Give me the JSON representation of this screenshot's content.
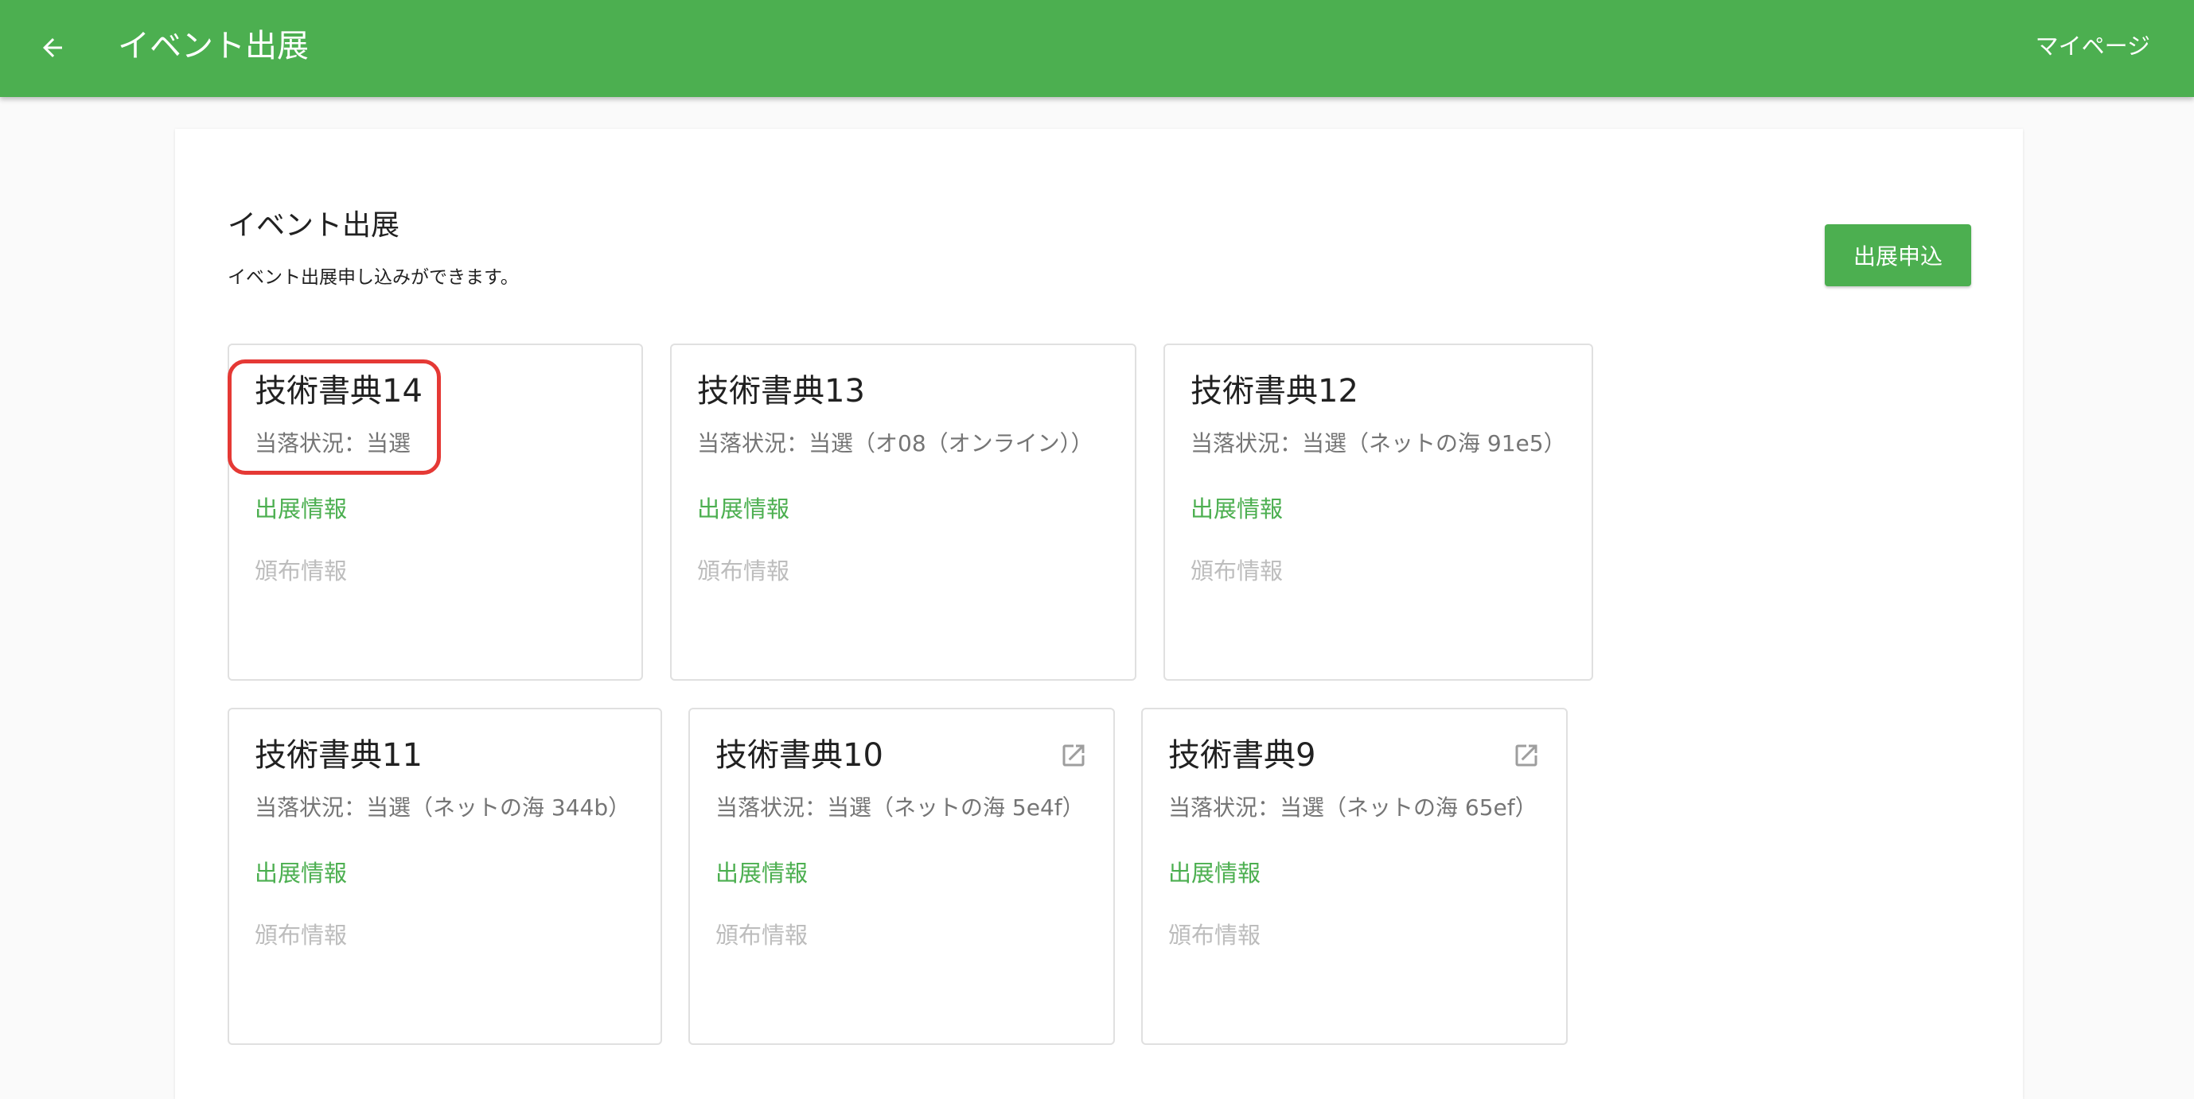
{
  "header": {
    "back_icon": "arrow-left-icon",
    "title": "イベント出展",
    "mypage_label": "マイページ",
    "bar_color": "#4caf50"
  },
  "main": {
    "title": "イベント出展",
    "description": "イベント出展申し込みができます。",
    "apply_button": "出展申込"
  },
  "cards": [
    {
      "title": "技術書典14",
      "status": "当落状況：当選",
      "exhibit_link": "出展情報",
      "distribution_link": "頒布情報",
      "external_link_icon": false
    },
    {
      "title": "技術書典13",
      "status": "当落状況：当選（オ08（オンライン））",
      "exhibit_link": "出展情報",
      "distribution_link": "頒布情報",
      "external_link_icon": false
    },
    {
      "title": "技術書典12",
      "status": "当落状況：当選（ネットの海 91e5）",
      "exhibit_link": "出展情報",
      "distribution_link": "頒布情報",
      "external_link_icon": false
    },
    {
      "title": "技術書典11",
      "status": "当落状況：当選（ネットの海 344b）",
      "exhibit_link": "出展情報",
      "distribution_link": "頒布情報",
      "external_link_icon": false
    },
    {
      "title": "技術書典10",
      "status": "当落状況：当選（ネットの海 5e4f）",
      "exhibit_link": "出展情報",
      "distribution_link": "頒布情報",
      "external_link_icon": true
    },
    {
      "title": "技術書典9",
      "status": "当落状況：当選（ネットの海 65ef）",
      "exhibit_link": "出展情報",
      "distribution_link": "頒布情報",
      "external_link_icon": true
    }
  ],
  "annotation": {
    "highlight_color": "#e53935"
  }
}
